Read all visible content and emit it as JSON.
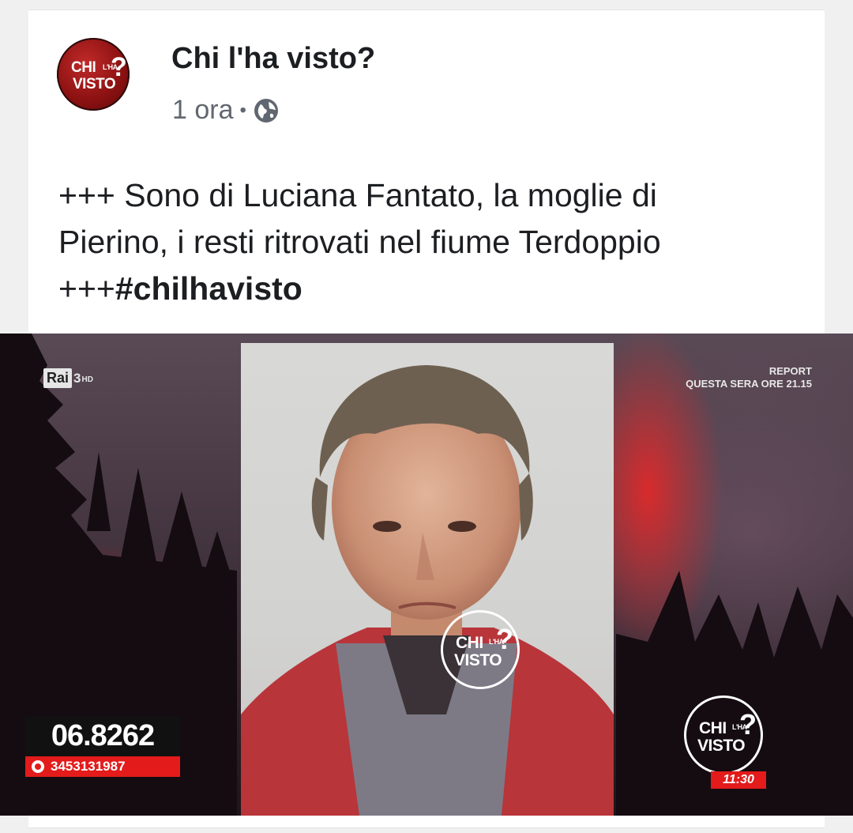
{
  "post": {
    "page_name": "Chi l'ha visto?",
    "time": "1 ora",
    "separator": "•",
    "privacy_icon": "globe-icon",
    "avatar_logo": {
      "line1": "CHI",
      "small": "L'HA",
      "line2": "VISTO",
      "mark": "?"
    },
    "text_lines": [
      "+++ Sono di Luciana Fantato, la moglie di",
      "Pierino, i resti ritrovati nel fiume Terdoppio"
    ],
    "text_last_prefix": "+++",
    "hashtag": "#chilhavisto"
  },
  "media": {
    "channel": {
      "name": "Rai",
      "number": "3",
      "suffix": "HD"
    },
    "promo": {
      "line1": "REPORT",
      "line2": "QUESTA SERA ORE 21.15"
    },
    "phone": {
      "main": "06.8262",
      "whatsapp": "3453131987"
    },
    "watermark": {
      "line1": "CHI",
      "small": "L'HA",
      "line2": "VISTO",
      "mark": "?"
    },
    "corner_logo": {
      "line1": "CHI",
      "small": "L'HA",
      "line2": "VISTO",
      "mark": "?"
    },
    "time": "11:30",
    "colors": {
      "accent_red": "#e31b1b",
      "logo_red": "#8e1212"
    }
  }
}
